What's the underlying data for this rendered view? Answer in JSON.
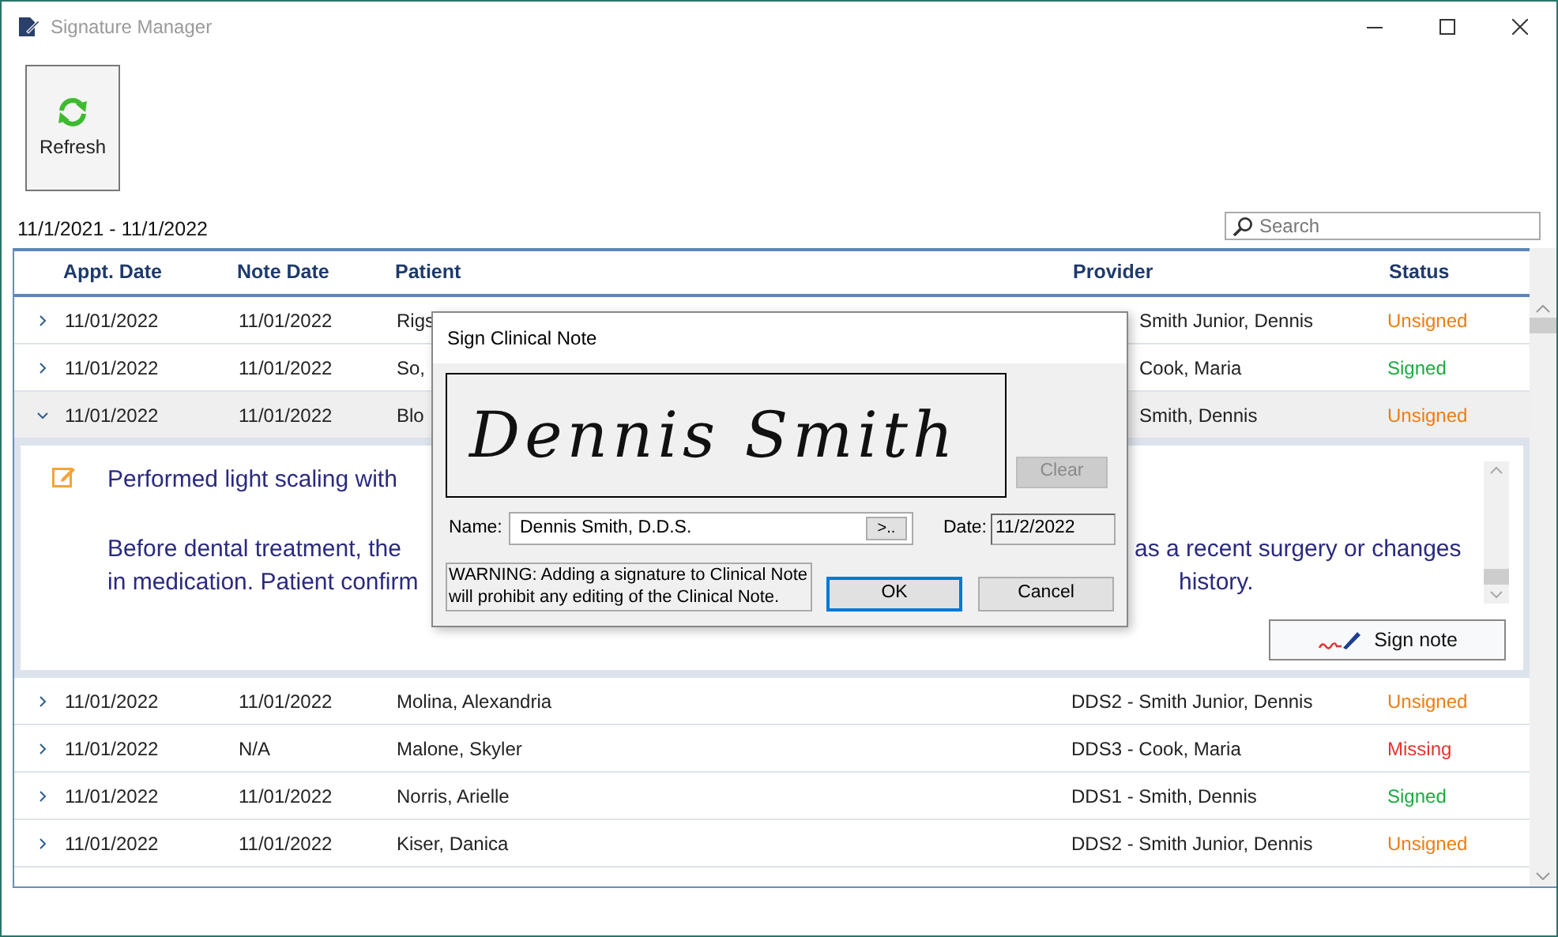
{
  "window": {
    "title": "Signature Manager"
  },
  "toolbar": {
    "refresh_label": "Refresh"
  },
  "date_range": "11/1/2021 - 11/1/2022",
  "search": {
    "placeholder": "Search"
  },
  "table": {
    "columns": [
      "Appt. Date",
      "Note Date",
      "Patient",
      "Provider",
      "Status"
    ],
    "rows": [
      {
        "expanded": false,
        "appt_date": "11/01/2022",
        "note_date": "11/01/2022",
        "patient": "Rigs",
        "provider": "Smith Junior, Dennis",
        "status": "Unsigned",
        "color": "#f07c10"
      },
      {
        "expanded": false,
        "appt_date": "11/01/2022",
        "note_date": "11/01/2022",
        "patient": "So,",
        "provider": "Cook, Maria",
        "status": "Signed",
        "color": "#1aab40"
      },
      {
        "expanded": true,
        "appt_date": "11/01/2022",
        "note_date": "11/01/2022",
        "patient": "Blo",
        "provider": "Smith, Dennis",
        "status": "Unsigned",
        "color": "#f07c10"
      },
      {
        "expanded": false,
        "appt_date": "11/01/2022",
        "note_date": "11/01/2022",
        "patient": "Molina, Alexandria",
        "provider": "DDS2 - Smith Junior, Dennis",
        "status": "Unsigned",
        "color": "#f07c10"
      },
      {
        "expanded": false,
        "appt_date": "11/01/2022",
        "note_date": "N/A",
        "patient": "Malone, Skyler",
        "provider": "DDS3 - Cook, Maria",
        "status": "Missing",
        "color": "#e8322e"
      },
      {
        "expanded": false,
        "appt_date": "11/01/2022",
        "note_date": "11/01/2022",
        "patient": "Norris, Arielle",
        "provider": "DDS1 - Smith, Dennis",
        "status": "Signed",
        "color": "#1aab40"
      },
      {
        "expanded": false,
        "appt_date": "11/01/2022",
        "note_date": "11/01/2022",
        "patient": "Kiser, Danica",
        "provider": "DDS2 - Smith Junior, Dennis",
        "status": "Unsigned",
        "color": "#f07c10"
      }
    ]
  },
  "note": {
    "lines": [
      {
        "left": "Performed light scaling with"
      },
      {
        "left": "Before dental treatment, the",
        "right": "as a recent surgery or changes"
      },
      {
        "left": "in medication. Patient confirm",
        "right": "history."
      }
    ],
    "sign_button": "Sign note"
  },
  "dialog": {
    "title": "Sign Clinical Note",
    "signature": "Dennis Smith",
    "clear_button": "Clear",
    "clear_disabled": true,
    "name_label": "Name:",
    "name_value": "Dennis Smith, D.D.S.",
    "browse_button": ">..",
    "date_label": "Date:",
    "date_value": "11/2/2022",
    "warning": "WARNING: Adding a signature to Clinical Note will prohibit any editing of the Clinical Note.",
    "ok_button": "OK",
    "cancel_button": "Cancel"
  }
}
